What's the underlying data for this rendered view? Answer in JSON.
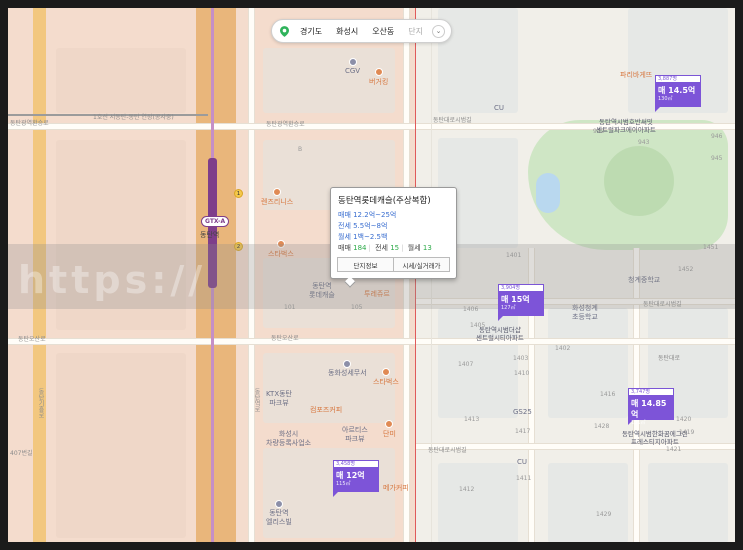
{
  "location_bar": {
    "province": "경기도",
    "city": "화성시",
    "district": "오산동",
    "level": "단지"
  },
  "road_labels": [
    "1호선 서동탄-동탄 연장(공사중)",
    "동탄광역환승로",
    "동탄광역환승로",
    "동탄대로시범길",
    "동탄오산로",
    "동탄오산로",
    "동탄대로시범길",
    "동탄대로시범길",
    "동탄기흥로",
    "407번길",
    "동탄역로",
    "동탄대로"
  ],
  "pois": {
    "cgv": "CGV",
    "burger_king": "버거킹",
    "paris_baguette": "파리바게뜨",
    "cu_top": "CU",
    "lens": "렌즈리니스",
    "starbucks_1": "스타벅스",
    "lotte_castle": "동탄역\n롯데캐슬",
    "lotte_mall": "투레쥬르",
    "health_center": "동화성세무서",
    "ktx": "KTX동탄\n파크뷰",
    "compose": "컴포즈커피",
    "starbucks_2": "스타벅스",
    "danmi": "단미",
    "hwaseong_car": "화성시\n차량등록사업소",
    "arte": "아르티스\n파크뷰",
    "dongtan_ellis": "동탄역\n엘리스빌",
    "mega": "메가커피",
    "jungang": "청계중학교",
    "hwaseong_elem": "화성청계\n초등학교",
    "gs25": "GS25",
    "cu_bottom": "CU"
  },
  "apt_labels": {
    "apt1": "동탄역시범호반써밋\n센트럴파크에이아파트",
    "apt2": "동탄역시범더샵\n센트럴시티아파트",
    "apt3": "동탄역시범한화꿈에그린\n프레스티지아파트"
  },
  "map_numbers": [
    "942",
    "943",
    "946",
    "945",
    "1401",
    "1452",
    "1451",
    "1406",
    "1405",
    "1402",
    "1403",
    "1407",
    "1410",
    "1411",
    "1412",
    "1413",
    "1416",
    "1417",
    "1420",
    "1419",
    "1421",
    "1428",
    "1429",
    "101",
    "105",
    "B"
  ],
  "station": {
    "line_badge": "GTX-A",
    "name": "동탄역",
    "exits": [
      "1",
      "2"
    ]
  },
  "markers": [
    {
      "count": "3,887명",
      "price": "매 14.5억",
      "area": "130㎡"
    },
    {
      "count": "3,904명",
      "price": "매 15억",
      "area": "127㎡"
    },
    {
      "count": "3,747명",
      "price": "매 14.85억",
      "area": "131㎡"
    },
    {
      "count": "3,458명",
      "price": "매 12억",
      "area": "115㎡"
    }
  ],
  "popup": {
    "title": "동탄역롯데캐슬(주상복합)",
    "sale": "매매 12.2억~25억",
    "jeonse": "전세 5.5억~8억",
    "monthly": "월세 1백~2.5백",
    "count_sale_label": "매매",
    "count_sale": "184",
    "count_jeonse_label": "전세",
    "count_jeonse": "15",
    "count_monthly_label": "월세",
    "count_monthly": "13",
    "btn_info": "단지정보",
    "btn_price": "시세/실거래가"
  },
  "watermark": "https://"
}
